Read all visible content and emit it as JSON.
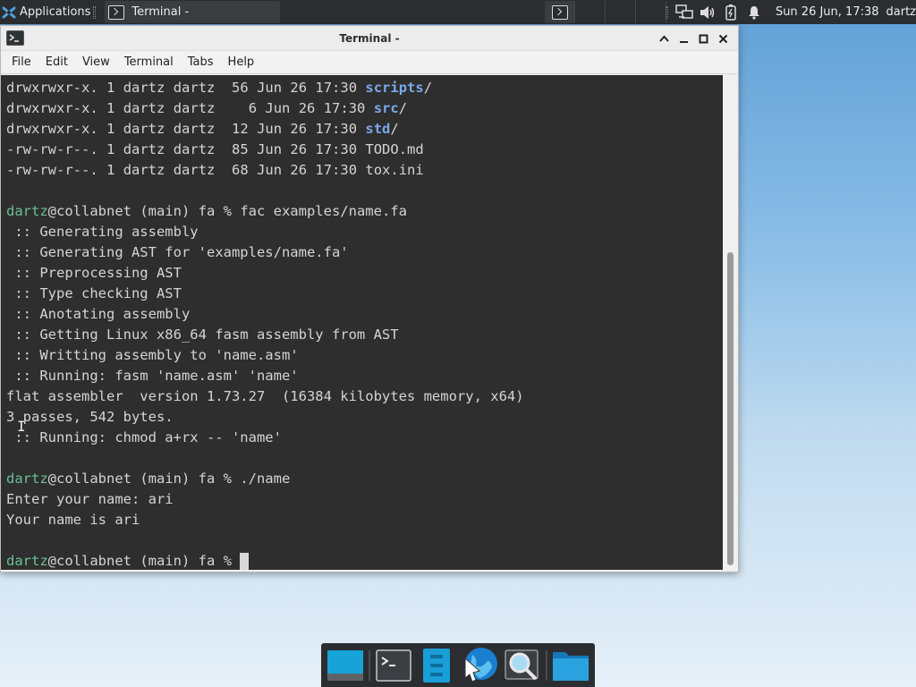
{
  "panel": {
    "applications_label": "Applications",
    "task_title": "Terminal -",
    "clock": "Sun 26 Jun, 17:38",
    "user": "dartz"
  },
  "window": {
    "title": "Terminal -",
    "menu": [
      "File",
      "Edit",
      "View",
      "Terminal",
      "Tabs",
      "Help"
    ]
  },
  "terminal": {
    "ls_rows": [
      {
        "perms": "drwxrwxr-x.",
        "links": "1",
        "owner": "dartz",
        "group": "dartz",
        "size": "56",
        "date": "Jun 26 17:30",
        "name": "scripts",
        "suffix": "/"
      },
      {
        "perms": "drwxrwxr-x.",
        "links": "1",
        "owner": "dartz",
        "group": "dartz",
        "size": "6",
        "date": "Jun 26 17:30",
        "name": "src",
        "suffix": "/"
      },
      {
        "perms": "drwxrwxr-x.",
        "links": "1",
        "owner": "dartz",
        "group": "dartz",
        "size": "12",
        "date": "Jun 26 17:30",
        "name": "std",
        "suffix": "/"
      },
      {
        "perms": "-rw-rw-r--.",
        "links": "1",
        "owner": "dartz",
        "group": "dartz",
        "size": "85",
        "date": "Jun 26 17:30",
        "name": "TODO.md",
        "suffix": ""
      },
      {
        "perms": "-rw-rw-r--.",
        "links": "1",
        "owner": "dartz",
        "group": "dartz",
        "size": "68",
        "date": "Jun 26 17:30",
        "name": "tox.ini",
        "suffix": ""
      }
    ],
    "prompt_user": "dartz",
    "prompt_rest": "@collabnet (main) fa % ",
    "cmd1": "fac examples/name.fa",
    "output1": [
      " :: Generating assembly",
      " :: Generating AST for 'examples/name.fa'",
      " :: Preprocessing AST",
      " :: Type checking AST",
      " :: Anotating assembly",
      " :: Getting Linux x86_64 fasm assembly from AST",
      " :: Writting assembly to 'name.asm'",
      " :: Running: fasm 'name.asm' 'name'",
      "flat assembler  version 1.73.27  (16384 kilobytes memory, x64)",
      "3 passes, 542 bytes.",
      " :: Running: chmod a+rx -- 'name'"
    ],
    "cmd2": "./name",
    "output2": [
      "Enter your name: ari",
      "Your name is ari"
    ],
    "ibeam": "I"
  },
  "icons": {
    "panel": [
      "xfce-icon",
      "terminal-icon",
      "network-icon",
      "volume-icon",
      "battery-icon",
      "notification-bell-icon"
    ],
    "dock": [
      "show-desktop-icon",
      "terminal-icon",
      "file-manager-icon",
      "web-browser-icon",
      "app-finder-icon",
      "folder-icon"
    ]
  },
  "colors": {
    "terminal_bg": "#2e2e2e",
    "prompt_user": "#6bbf94",
    "directory": "#7aa8ea",
    "panel_bg": "#2b2d30"
  }
}
